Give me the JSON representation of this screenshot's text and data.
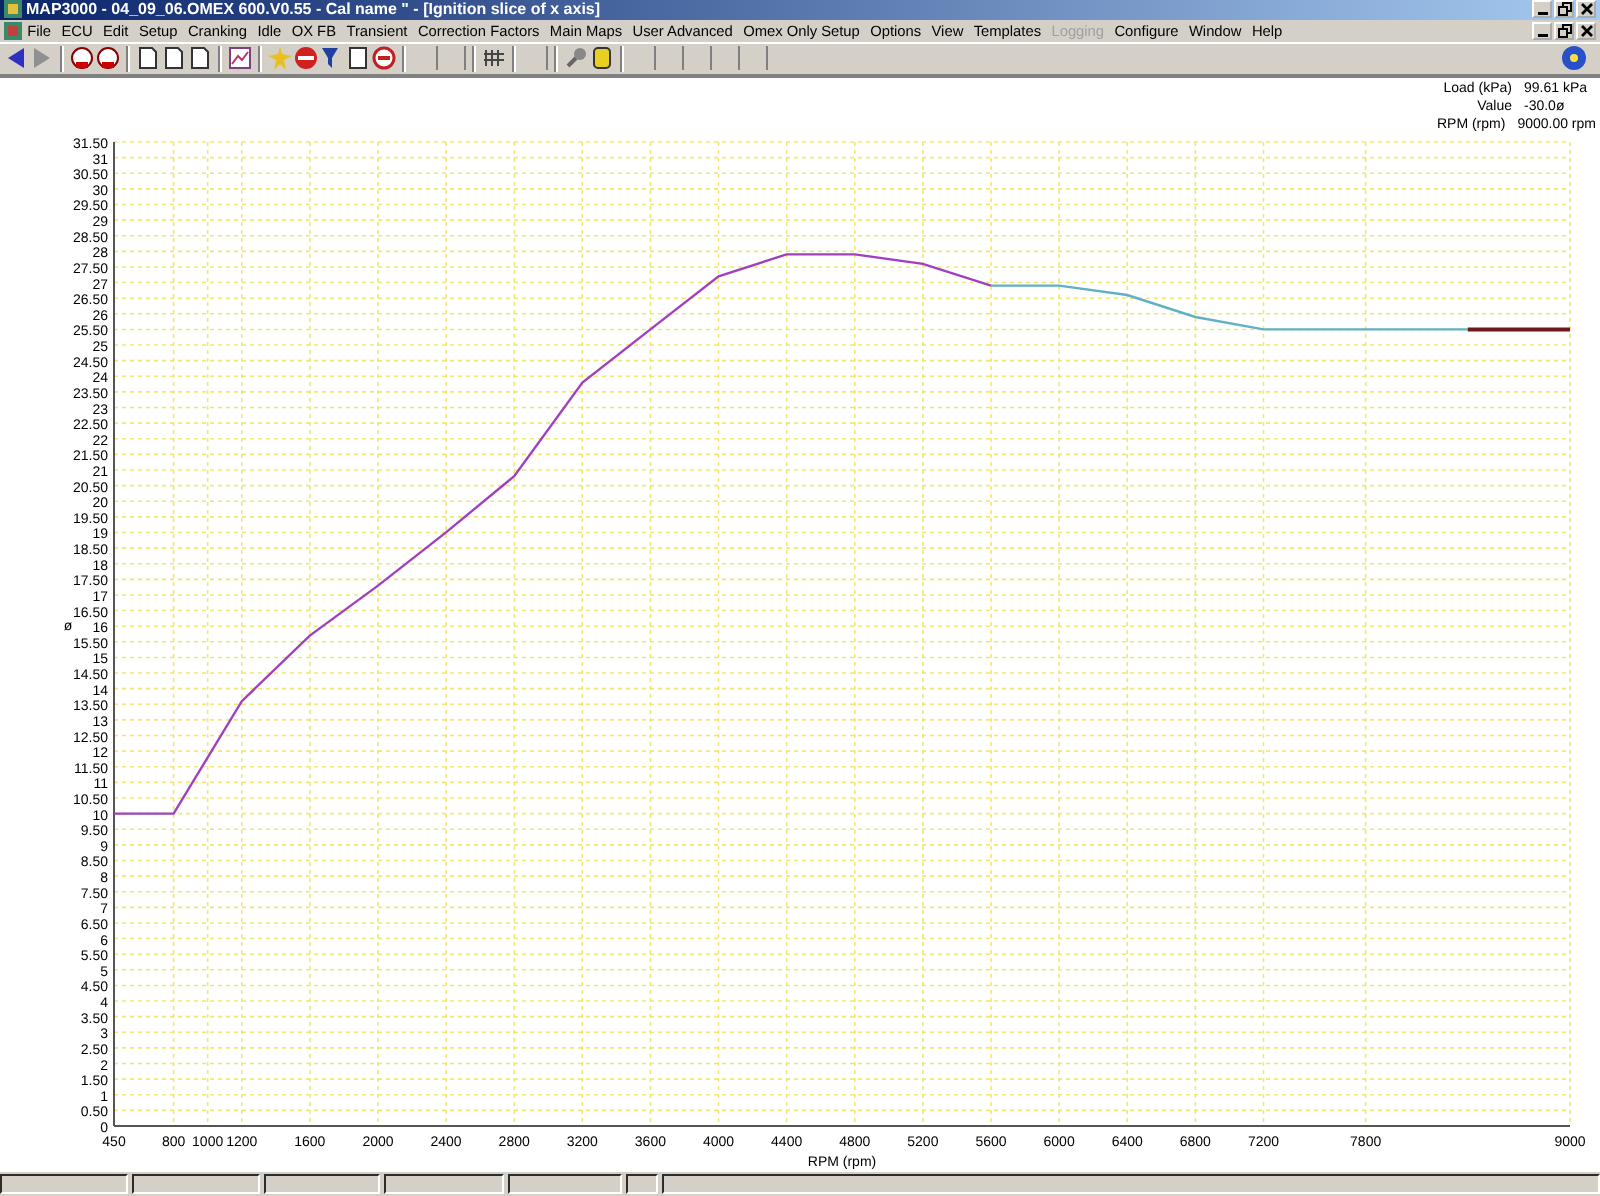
{
  "window": {
    "title": "MAP3000 - 04_09_06.OMEX 600.V0.55 - Cal name \" - [Ignition slice of x axis]"
  },
  "menu": [
    {
      "label": "File",
      "disabled": false
    },
    {
      "label": "ECU",
      "disabled": false
    },
    {
      "label": "Edit",
      "disabled": false
    },
    {
      "label": "Setup",
      "disabled": false
    },
    {
      "label": "Cranking",
      "disabled": false
    },
    {
      "label": "Idle",
      "disabled": false
    },
    {
      "label": "OX FB",
      "disabled": false
    },
    {
      "label": "Transient",
      "disabled": false
    },
    {
      "label": "Correction Factors",
      "disabled": false
    },
    {
      "label": "Main Maps",
      "disabled": false
    },
    {
      "label": "User Advanced",
      "disabled": false
    },
    {
      "label": "Omex Only Setup",
      "disabled": false
    },
    {
      "label": "Options",
      "disabled": false
    },
    {
      "label": "View",
      "disabled": false
    },
    {
      "label": "Templates",
      "disabled": false
    },
    {
      "label": "Logging",
      "disabled": true
    },
    {
      "label": "Configure",
      "disabled": false
    },
    {
      "label": "Window",
      "disabled": false
    },
    {
      "label": "Help",
      "disabled": false
    }
  ],
  "info": [
    {
      "label": "Load (kPa)",
      "value": "99.61 kPa"
    },
    {
      "label": "Value",
      "value": "-30.0ø"
    },
    {
      "label": "RPM (rpm)",
      "value": "9000.00 rpm"
    }
  ],
  "chart": {
    "chart_data": {
      "type": "line",
      "grid": true,
      "xlabel": "RPM (rpm)",
      "ylabel": "ø",
      "x": [
        450,
        800,
        1200,
        1600,
        2000,
        2400,
        2800,
        3200,
        3600,
        4000,
        4400,
        4800,
        5200,
        5600,
        6000,
        6400,
        6800,
        7200,
        7800,
        8400,
        9000
      ],
      "series": [
        {
          "color": "#a040c0",
          "values": [
            10,
            10,
            13.6,
            15.7,
            17.3,
            19,
            20.8,
            23.8,
            25.5,
            27.2,
            27.9,
            27.9,
            27.6,
            26.9,
            null,
            null,
            null,
            null,
            null,
            null,
            null
          ]
        },
        {
          "color": "#60b0c8",
          "values": [
            null,
            null,
            null,
            null,
            null,
            null,
            null,
            null,
            null,
            null,
            null,
            null,
            null,
            26.9,
            26.9,
            26.6,
            25.9,
            25.5,
            25.5,
            25.5,
            null
          ]
        },
        {
          "color": "#701818",
          "values": [
            null,
            null,
            null,
            null,
            null,
            null,
            null,
            null,
            null,
            null,
            null,
            null,
            null,
            null,
            null,
            null,
            null,
            null,
            null,
            25.5,
            25.5
          ]
        }
      ],
      "xlim": [
        450,
        9000
      ],
      "ylim": [
        0,
        31.5
      ],
      "xticks": [
        450,
        800,
        1000,
        1200,
        1600,
        2000,
        2400,
        2800,
        3200,
        3600,
        4000,
        4400,
        4800,
        5200,
        5600,
        6000,
        6400,
        6800,
        7200,
        7800,
        9000
      ],
      "yticks": [
        {
          "value": 0,
          "label": "0"
        },
        {
          "value": 0.5,
          "label": "0.50"
        },
        {
          "value": 1,
          "label": "1"
        },
        {
          "value": 1.5,
          "label": "1.50"
        },
        {
          "value": 2,
          "label": "2"
        },
        {
          "value": 2.5,
          "label": "2.50"
        },
        {
          "value": 3,
          "label": "3"
        },
        {
          "value": 3.5,
          "label": "3.50"
        },
        {
          "value": 4,
          "label": "4"
        },
        {
          "value": 4.5,
          "label": "4.50"
        },
        {
          "value": 5,
          "label": "5"
        },
        {
          "value": 5.5,
          "label": "5.50"
        },
        {
          "value": 6,
          "label": "6"
        },
        {
          "value": 6.5,
          "label": "6.50"
        },
        {
          "value": 7,
          "label": "7"
        },
        {
          "value": 7.5,
          "label": "7.50"
        },
        {
          "value": 8,
          "label": "8"
        },
        {
          "value": 8.5,
          "label": "8.50"
        },
        {
          "value": 9,
          "label": "9"
        },
        {
          "value": 9.5,
          "label": "9.50"
        },
        {
          "value": 10,
          "label": "10"
        },
        {
          "value": 10.5,
          "label": "10.50"
        },
        {
          "value": 11,
          "label": "11"
        },
        {
          "value": 11.5,
          "label": "11.50"
        },
        {
          "value": 12,
          "label": "12"
        },
        {
          "value": 12.5,
          "label": "12.50"
        },
        {
          "value": 13,
          "label": "13"
        },
        {
          "value": 13.5,
          "label": "13.50"
        },
        {
          "value": 14,
          "label": "14"
        },
        {
          "value": 14.5,
          "label": "14.50"
        },
        {
          "value": 15,
          "label": "15"
        },
        {
          "value": 15.5,
          "label": "15.50"
        },
        {
          "value": 16,
          "label": "16"
        },
        {
          "value": 16.5,
          "label": "16.50"
        },
        {
          "value": 17,
          "label": "17"
        },
        {
          "value": 17.5,
          "label": "17.50"
        },
        {
          "value": 18,
          "label": "18"
        },
        {
          "value": 18.5,
          "label": "18.50"
        },
        {
          "value": 19,
          "label": "19"
        },
        {
          "value": 19.5,
          "label": "19.50"
        },
        {
          "value": 20,
          "label": "20"
        },
        {
          "value": 20.5,
          "label": "20.50"
        },
        {
          "value": 21,
          "label": "21"
        },
        {
          "value": 21.5,
          "label": "21.50"
        },
        {
          "value": 22,
          "label": "22"
        },
        {
          "value": 22.5,
          "label": "22.50"
        },
        {
          "value": 23,
          "label": "23"
        },
        {
          "value": 23.5,
          "label": "23.50"
        },
        {
          "value": 24,
          "label": "24"
        },
        {
          "value": 24.5,
          "label": "24.50"
        },
        {
          "value": 25,
          "label": "25"
        },
        {
          "value": 25.5,
          "label": "25.50"
        },
        {
          "value": 26,
          "label": "26"
        },
        {
          "value": 26.5,
          "label": "26.50"
        },
        {
          "value": 27,
          "label": "27"
        },
        {
          "value": 27.5,
          "label": "27.50"
        },
        {
          "value": 28,
          "label": "28"
        },
        {
          "value": 28.5,
          "label": "28.50"
        },
        {
          "value": 29,
          "label": "29"
        },
        {
          "value": 29.5,
          "label": "29.50"
        },
        {
          "value": 30,
          "label": "30"
        },
        {
          "value": 30.5,
          "label": "30.50"
        },
        {
          "value": 31,
          "label": "31"
        },
        {
          "value": 31.5,
          "label": "31.50"
        }
      ]
    }
  }
}
